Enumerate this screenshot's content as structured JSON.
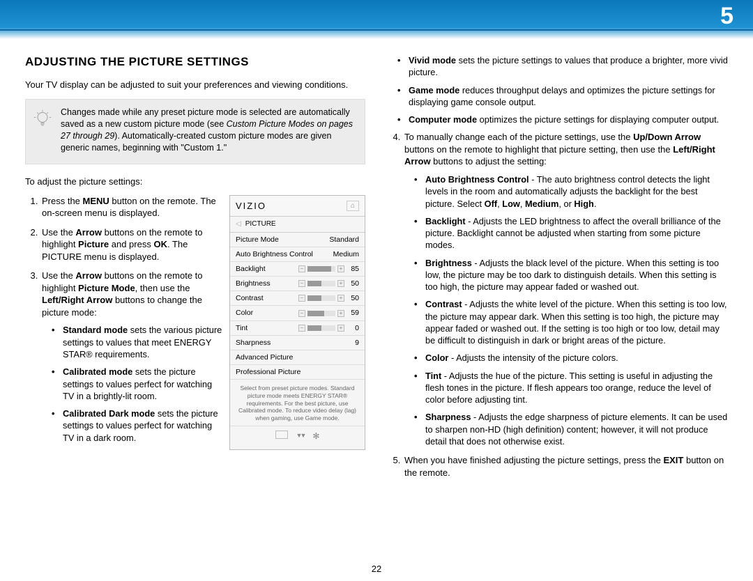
{
  "chapter_number": "5",
  "page_number": "22",
  "heading": "ADJUSTING THE PICTURE SETTINGS",
  "lead": "Your TV display can be adjusted to suit your preferences and viewing conditions.",
  "note_text_a": "Changes made while any preset picture mode is selected are automatically saved as a new custom picture mode (see ",
  "note_text_italic": "Custom Picture Modes on pages 27 through 29",
  "note_text_b": "). Automatically-created custom picture modes are given generic names, beginning with \"Custom 1.\"",
  "steps_intro": "To adjust the picture settings:",
  "step1_a": "Press the ",
  "step1_menu": "MENU",
  "step1_b": " button on the remote. The on-screen menu is displayed.",
  "step2_a": "Use the ",
  "step2_arrow": "Arrow",
  "step2_b": " buttons on the remote to highlight ",
  "step2_picture": "Picture",
  "step2_c": " and press ",
  "step2_ok": "OK",
  "step2_d": ". The PICTURE menu is displayed.",
  "step3_a": "Use the ",
  "step3_arrow": "Arrow",
  "step3_b": " buttons on the remote to highlight ",
  "step3_pm": "Picture Mode",
  "step3_c": ", then use the ",
  "step3_lr": "Left/Right Arrow",
  "step3_d": " buttons to change the picture mode:",
  "mode_standard_b": "Standard mode",
  "mode_standard_t": " sets the various picture settings to values that meet ENERGY STAR® requirements.",
  "mode_calibrated_b": "Calibrated mode",
  "mode_calibrated_t": " sets the picture settings to values perfect for watching TV in a brightly-lit room.",
  "mode_caldark_b": "Calibrated Dark mode",
  "mode_caldark_t": " sets the picture settings to values perfect for watching TV in a dark room.",
  "mode_vivid_b": "Vivid mode",
  "mode_vivid_t": " sets the picture settings to values that produce a brighter, more vivid picture.",
  "mode_game_b": "Game mode",
  "mode_game_t": " reduces throughput delays and optimizes the picture settings for displaying game console output.",
  "mode_computer_b": "Computer mode",
  "mode_computer_t": " optimizes the picture settings for displaying computer output.",
  "step4_a": "To manually change each of the picture settings, use the ",
  "step4_ud": "Up/Down Arrow",
  "step4_b": " buttons on the remote to highlight that picture setting, then use the ",
  "step4_lr": "Left/Right Arrow",
  "step4_c": " buttons to adjust the setting:",
  "set_abc_b": "Auto Brightness Control",
  "set_abc_t": " - The auto brightness control detects the light levels in the room and automatically adjusts the backlight for the best picture. Select ",
  "set_abc_off": "Off",
  "set_abc_comma1": ", ",
  "set_abc_low": "Low",
  "set_abc_comma2": ", ",
  "set_abc_med": "Medium",
  "set_abc_comma3": ", or ",
  "set_abc_high": "High",
  "set_abc_period": ".",
  "set_backlight_b": "Backlight",
  "set_backlight_t": " - Adjusts the LED brightness to affect the overall brilliance of the picture. Backlight cannot be adjusted when starting from some picture modes.",
  "set_brightness_b": "Brightness",
  "set_brightness_t": " - Adjusts the black level of the picture. When this setting is too low, the picture may be too dark to distinguish details. When this setting is too high, the picture may appear faded or washed out.",
  "set_contrast_b": "Contrast",
  "set_contrast_t": " - Adjusts the white level of the picture. When this setting is too low, the picture may appear dark. When this setting is too high, the picture may appear faded or washed out. If the setting is too high or too low, detail may be difficult to distinguish in dark or bright areas of the picture.",
  "set_color_b": "Color",
  "set_color_t": " - Adjusts the intensity of the picture colors.",
  "set_tint_b": "Tint",
  "set_tint_t": " - Adjusts the hue of the picture. This setting is useful in adjusting the flesh tones in the picture. If flesh appears too orange, reduce the level of color before adjusting tint.",
  "set_sharp_b": "Sharpness",
  "set_sharp_t": " - Adjusts the edge sharpness of picture elements. It can be used to sharpen non-HD (high definition) content; however, it will not produce detail that does not otherwise exist.",
  "step5_a": "When you have finished adjusting the picture settings, press the ",
  "step5_exit": "EXIT",
  "step5_b": " button on the remote.",
  "tv": {
    "logo": "VIZIO",
    "breadcrumb": "PICTURE",
    "row_pm_l": "Picture Mode",
    "row_pm_v": "Standard",
    "row_abc_l": "Auto Brightness Control",
    "row_abc_v": "Medium",
    "row_bl_l": "Backlight",
    "row_bl_v": "85",
    "row_br_l": "Brightness",
    "row_br_v": "50",
    "row_ct_l": "Contrast",
    "row_ct_v": "50",
    "row_co_l": "Color",
    "row_co_v": "59",
    "row_ti_l": "Tint",
    "row_ti_v": "0",
    "row_sh_l": "Sharpness",
    "row_sh_v": "9",
    "row_adv": "Advanced Picture",
    "row_pro": "Professional Picture",
    "help": "Select from preset picture modes. Standard picture mode meets ENERGY STAR® requirements. For the best picture, use Calibrated mode. To reduce video delay (lag) when gaming, use Game mode."
  }
}
